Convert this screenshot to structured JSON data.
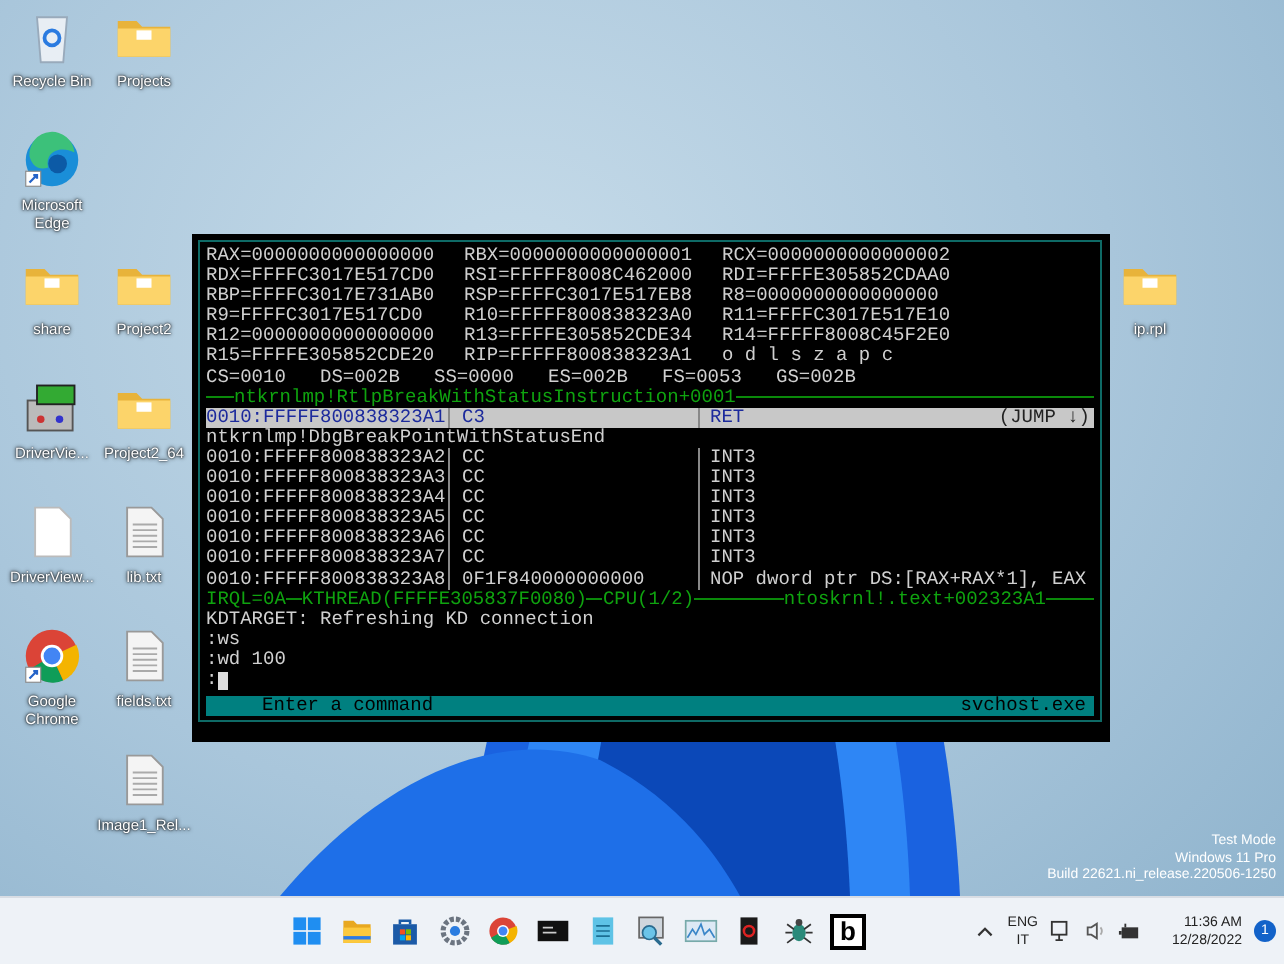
{
  "desktop": {
    "columns": [
      [
        {
          "label": "Recycle Bin",
          "kind": "recycle-bin",
          "shortcut": false
        },
        {
          "label": "Microsoft Edge",
          "kind": "edge",
          "shortcut": true
        },
        {
          "label": "share",
          "kind": "folder",
          "shortcut": false
        },
        {
          "label": "DriverVie...",
          "kind": "app",
          "shortcut": false
        },
        {
          "label": "DriverView...",
          "kind": "blank-file",
          "shortcut": false
        },
        {
          "label": "Google Chrome",
          "kind": "chrome",
          "shortcut": true
        }
      ],
      [
        {
          "label": "Projects",
          "kind": "folder",
          "shortcut": false
        },
        {
          "label": "Project2",
          "kind": "folder",
          "shortcut": false
        },
        {
          "label": "Project2_64",
          "kind": "folder",
          "shortcut": false
        },
        {
          "label": "lib.txt",
          "kind": "text-file",
          "shortcut": false
        },
        {
          "label": "fields.txt",
          "kind": "text-file",
          "shortcut": false
        },
        {
          "label": "Image1_Rel...",
          "kind": "text-file",
          "shortcut": false
        }
      ],
      [
        {
          "label": "ip.rpl",
          "kind": "folder",
          "shortcut": false
        }
      ]
    ]
  },
  "debugger": {
    "registers": [
      [
        "RAX=0000000000000000",
        "RBX=0000000000000001",
        "RCX=0000000000000002"
      ],
      [
        "RDX=FFFFC3017E517CD0",
        "RSI=FFFFF8008C462000",
        "RDI=FFFFE305852CDAA0"
      ],
      [
        "RBP=FFFFC3017E731AB0",
        "RSP=FFFFC3017E517EB8",
        "R8=0000000000000000"
      ],
      [
        "R9=FFFFC3017E517CD0",
        "R10=FFFFF800838323A0",
        "R11=FFFFC3017E517E10"
      ],
      [
        "R12=0000000000000000",
        "R13=FFFFE305852CDE34",
        "R14=FFFFF8008C45F2E0"
      ],
      [
        "R15=FFFFE305852CDE20",
        "RIP=FFFFF800838323A1",
        "o d l s z a p c"
      ]
    ],
    "segments": [
      "CS=0010",
      "DS=002B",
      "SS=0000",
      "ES=002B",
      "FS=0053",
      "GS=002B"
    ],
    "symbol_header": "ntkrnlmp!RtlpBreakWithStatusInstruction+0001",
    "disassembly": [
      {
        "kind": "instruction",
        "address": "0010:FFFFF800838323A1",
        "bytes": "C3",
        "instruction": "RET",
        "note": "(JUMP ↓)",
        "selected": true
      },
      {
        "kind": "label",
        "text": "ntkrnlmp!DbgBreakPointWithStatusEnd",
        "selected": false
      },
      {
        "kind": "instruction",
        "address": "0010:FFFFF800838323A2",
        "bytes": "CC",
        "instruction": "INT3",
        "selected": false
      },
      {
        "kind": "instruction",
        "address": "0010:FFFFF800838323A3",
        "bytes": "CC",
        "instruction": "INT3",
        "selected": false
      },
      {
        "kind": "instruction",
        "address": "0010:FFFFF800838323A4",
        "bytes": "CC",
        "instruction": "INT3",
        "selected": false
      },
      {
        "kind": "instruction",
        "address": "0010:FFFFF800838323A5",
        "bytes": "CC",
        "instruction": "INT3",
        "selected": false
      },
      {
        "kind": "instruction",
        "address": "0010:FFFFF800838323A6",
        "bytes": "CC",
        "instruction": "INT3",
        "selected": false
      },
      {
        "kind": "instruction",
        "address": "0010:FFFFF800838323A7",
        "bytes": "CC",
        "instruction": "INT3",
        "selected": false
      },
      {
        "kind": "instruction",
        "address": "0010:FFFFF800838323A8",
        "bytes": "0F1F840000000000",
        "instruction": "NOP dword ptr DS:[RAX+RAX*1], EAX",
        "selected": false
      }
    ],
    "status_line": {
      "parts": [
        "IRQL=0A",
        "KTHREAD(FFFFE305837F0080)",
        "CPU(1/2)"
      ],
      "location": "ntoskrnl!.text+002323A1"
    },
    "console": [
      "KDTARGET: Refreshing KD connection",
      ":ws",
      ":wd 100"
    ],
    "prompt": ":",
    "command_bar": {
      "hint": "Enter a command",
      "process": "svchost.exe"
    }
  },
  "watermark_info": [
    "Test Mode",
    "Windows 11 Pro",
    "Build 22621.ni_release.220506-1250"
  ],
  "taskbar": {
    "apps": [
      {
        "kind": "start"
      },
      {
        "kind": "explorer"
      },
      {
        "kind": "store"
      },
      {
        "kind": "settings"
      },
      {
        "kind": "chrome"
      },
      {
        "kind": "terminal"
      },
      {
        "kind": "notepad"
      },
      {
        "kind": "magnifier"
      },
      {
        "kind": "monitor"
      },
      {
        "kind": "red-app"
      },
      {
        "kind": "bug"
      },
      {
        "kind": "letter",
        "label": "b"
      }
    ],
    "language": [
      "ENG",
      "IT"
    ],
    "time": "11:36 AM",
    "date": "12/28/2022",
    "notifications": "1"
  }
}
